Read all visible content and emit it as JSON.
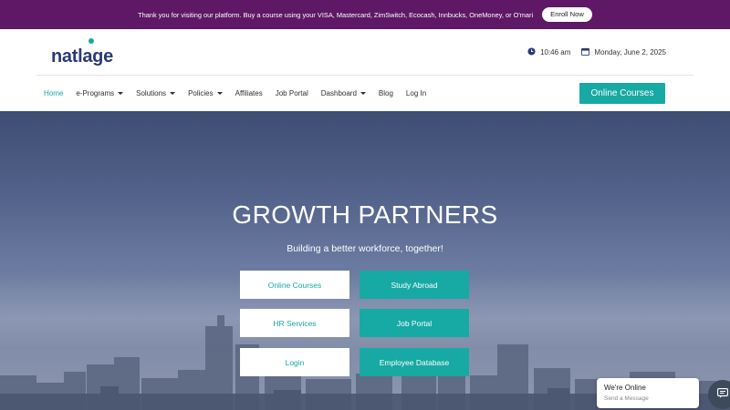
{
  "announcement": {
    "message": "Thank you for visiting our platform. Buy a course using your VISA, Mastercard, ZimSwitch, Ecocash, Innbucks, OneMoney, or O'mari",
    "enroll_label": "Enroll Now"
  },
  "header": {
    "logo_text": "natlage",
    "time": "10:46 am",
    "date": "Monday, June 2, 2025"
  },
  "nav": {
    "items": [
      {
        "label": "Home",
        "dropdown": false
      },
      {
        "label": "e-Programs",
        "dropdown": true
      },
      {
        "label": "Solutions",
        "dropdown": true
      },
      {
        "label": "Policies",
        "dropdown": true
      },
      {
        "label": "Affiliates",
        "dropdown": false
      },
      {
        "label": "Job Portal",
        "dropdown": false
      },
      {
        "label": "Dashboard",
        "dropdown": true
      },
      {
        "label": "Blog",
        "dropdown": false
      },
      {
        "label": "Log In",
        "dropdown": false
      }
    ],
    "active": "Home",
    "cta_label": "Online Courses"
  },
  "hero": {
    "title": "GROWTH PARTNERS",
    "subtitle": "Building a better workforce, together!",
    "buttons": [
      {
        "label": "Online Courses",
        "style": "white"
      },
      {
        "label": "Study Abroad",
        "style": "teal"
      },
      {
        "label": "HR Services",
        "style": "white"
      },
      {
        "label": "Job Portal",
        "style": "teal"
      },
      {
        "label": "Login",
        "style": "white"
      },
      {
        "label": "Employee Database",
        "style": "teal"
      }
    ]
  },
  "chat": {
    "status": "We're Online",
    "prompt": "Send a Message"
  },
  "colors": {
    "brand_purple": "#5e1866",
    "accent_teal": "#17a9a4",
    "logo_navy": "#2a3a78"
  },
  "icons": {
    "time": "clock-icon",
    "date": "calendar-icon",
    "chat": "chat-bubble-icon"
  }
}
